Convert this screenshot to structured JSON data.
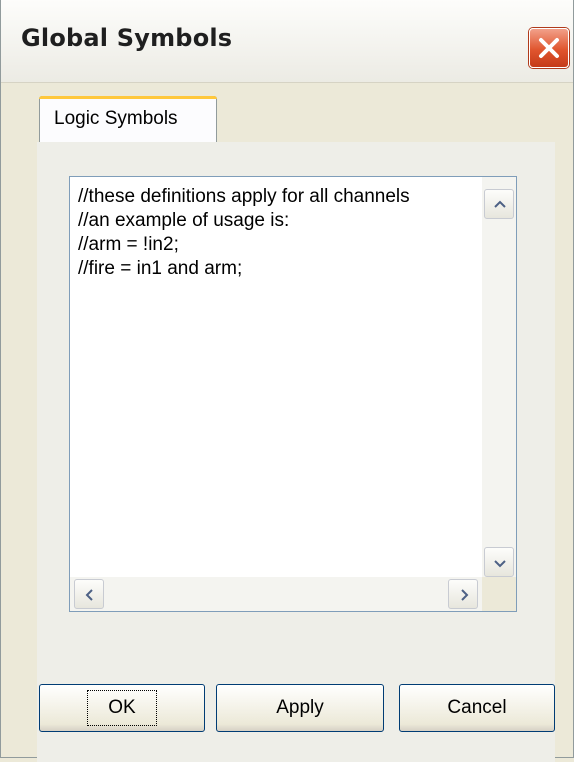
{
  "window": {
    "title": "Global Symbols"
  },
  "tabs": [
    {
      "label": "Logic Symbols"
    }
  ],
  "editor": {
    "lines": [
      "//these definitions apply for all channels",
      "//an example of usage is:",
      "//arm = !in2;",
      "//fire = in1 and arm;"
    ]
  },
  "buttons": {
    "ok": "OK",
    "apply": "Apply",
    "cancel": "Cancel"
  },
  "icons": {
    "close": "close-icon",
    "scroll_up": "arrow-up-icon",
    "scroll_down": "arrow-down-icon",
    "scroll_left": "arrow-left-icon",
    "scroll_right": "arrow-right-icon"
  },
  "colors": {
    "window_bg": "#ece9d8",
    "close_button": "#e0552e",
    "tab_accent": "#ffc83c",
    "button_border": "#003c74"
  }
}
